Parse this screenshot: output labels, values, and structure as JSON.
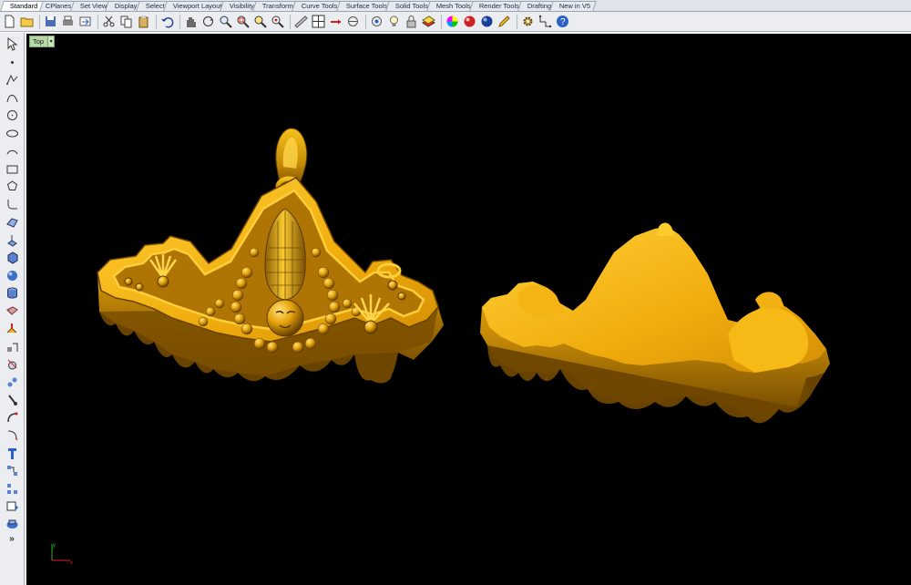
{
  "tabs": [
    {
      "label": "Standard",
      "active": true
    },
    {
      "label": "CPlanes",
      "active": false
    },
    {
      "label": "Set View",
      "active": false
    },
    {
      "label": "Display",
      "active": false
    },
    {
      "label": "Select",
      "active": false
    },
    {
      "label": "Viewport Layout",
      "active": false
    },
    {
      "label": "Visibility",
      "active": false
    },
    {
      "label": "Transform",
      "active": false
    },
    {
      "label": "Curve Tools",
      "active": false
    },
    {
      "label": "Surface Tools",
      "active": false
    },
    {
      "label": "Solid Tools",
      "active": false
    },
    {
      "label": "Mesh Tools",
      "active": false
    },
    {
      "label": "Render Tools",
      "active": false
    },
    {
      "label": "Drafting",
      "active": false
    },
    {
      "label": "New in V5",
      "active": false
    }
  ],
  "toolbar_icons": [
    "new-file-icon",
    "open-folder-icon",
    "save-icon",
    "print-icon",
    "import-icon",
    "cut-icon",
    "copy-icon",
    "paste-icon",
    "undo-icon",
    "pan-hand-icon",
    "rotate-view-icon",
    "zoom-icon",
    "zoom-window-icon",
    "zoom-extents-icon",
    "zoom-selected-icon",
    "shade-icon",
    "four-viewports-icon",
    "select-all-icon",
    "hide-objects-icon",
    "show-objects-icon",
    "light-bulb-icon",
    "lock-icon",
    "layer-icon",
    "color-wheel-icon",
    "material-icon",
    "render-sphere-icon",
    "edit-properties-icon",
    "settings-gear-icon",
    "grid-snap-icon",
    "help-icon"
  ],
  "left_tools": [
    "select-arrow-icon",
    "point-icon",
    "polyline-icon",
    "curve-icon",
    "circle-icon",
    "ellipse-icon",
    "arc-icon",
    "rectangle-icon",
    "polygon-icon",
    "fillet-curve-icon",
    "surface-icon",
    "extrude-icon",
    "box-solid-icon",
    "sphere-solid-icon",
    "cylinder-solid-icon",
    "mesh-icon",
    "transform-icon",
    "dimension-icon",
    "trim-icon",
    "group-icon",
    "boolean-icon",
    "join-icon",
    "explode-icon",
    "text-icon",
    "array-icon",
    "mirror-icon",
    "snapshot-icon",
    "analyze-icon"
  ],
  "left_more": "»",
  "viewport": {
    "label": "Top",
    "dropdown": "▾"
  },
  "colors": {
    "gold": "#f2b112",
    "gold_dark": "#9a6a05",
    "gold_shadow": "#4e3300",
    "bg": "#000000"
  }
}
